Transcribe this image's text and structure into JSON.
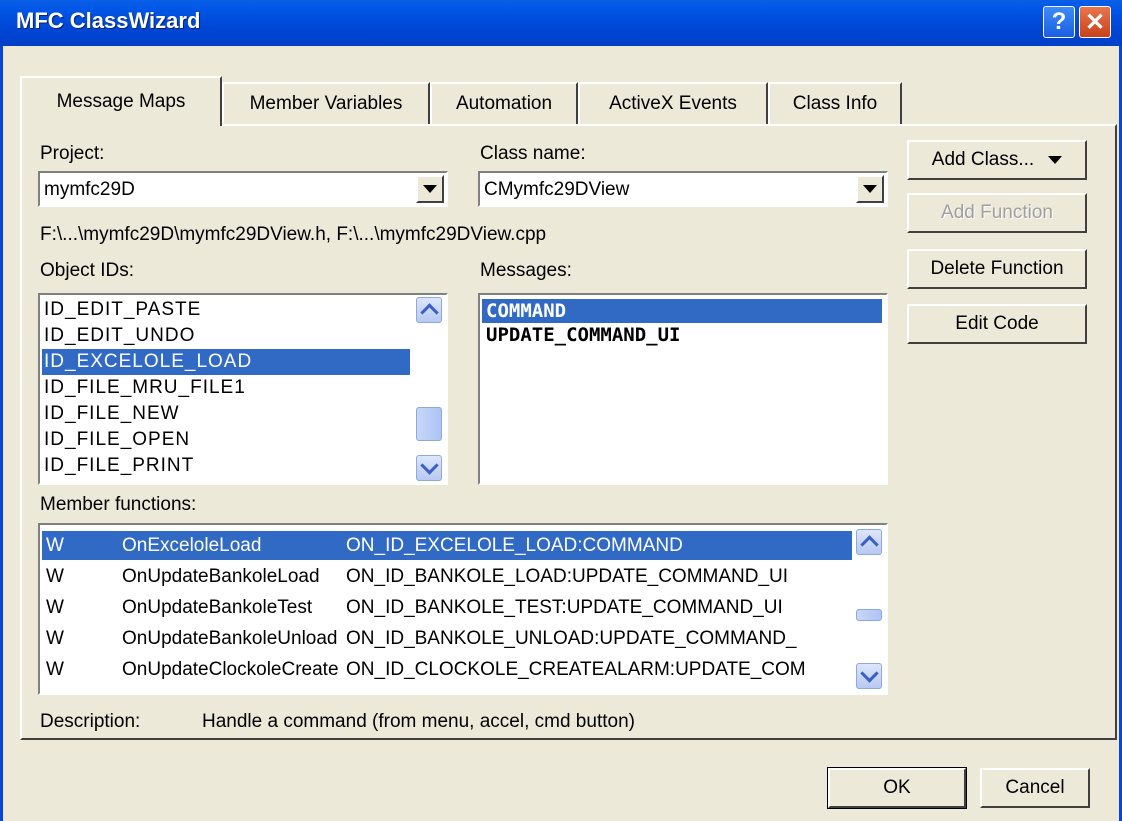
{
  "window": {
    "title": "MFC ClassWizard",
    "help_label": "?",
    "close_label": "✕"
  },
  "tabs": [
    {
      "label": "Message Maps",
      "active": true
    },
    {
      "label": "Member Variables"
    },
    {
      "label": "Automation"
    },
    {
      "label": "ActiveX Events"
    },
    {
      "label": "Class Info"
    }
  ],
  "project": {
    "label": "Project:",
    "value": "mymfc29D"
  },
  "classname": {
    "label": "Class name:",
    "value": "CMymfc29DView"
  },
  "file_path": "F:\\...\\mymfc29D\\mymfc29DView.h, F:\\...\\mymfc29DView.cpp",
  "object_ids": {
    "label": "Object IDs:",
    "items": [
      "ID_EDIT_PASTE",
      "ID_EDIT_UNDO",
      "ID_EXCELOLE_LOAD",
      "ID_FILE_MRU_FILE1",
      "ID_FILE_NEW",
      "ID_FILE_OPEN",
      "ID_FILE_PRINT"
    ],
    "selected": "ID_EXCELOLE_LOAD"
  },
  "messages": {
    "label": "Messages:",
    "items": [
      "COMMAND",
      "UPDATE_COMMAND_UI"
    ],
    "selected": "COMMAND"
  },
  "member_functions": {
    "label": "Member functions:",
    "rows": [
      {
        "marker": "W",
        "name": "OnExceloleLoad",
        "map": "ON_ID_EXCELOLE_LOAD:COMMAND",
        "selected": true
      },
      {
        "marker": "W",
        "name": "OnUpdateBankoleLoad",
        "map": "ON_ID_BANKOLE_LOAD:UPDATE_COMMAND_UI"
      },
      {
        "marker": "W",
        "name": "OnUpdateBankoleTest",
        "map": "ON_ID_BANKOLE_TEST:UPDATE_COMMAND_UI"
      },
      {
        "marker": "W",
        "name": "OnUpdateBankoleUnload",
        "map": "ON_ID_BANKOLE_UNLOAD:UPDATE_COMMAND_"
      },
      {
        "marker": "W",
        "name": "OnUpdateClockoleCreate",
        "map": "ON_ID_CLOCKOLE_CREATEALARM:UPDATE_COM"
      }
    ]
  },
  "description": {
    "label": "Description:",
    "text": "Handle a command (from menu, accel, cmd button)"
  },
  "buttons": {
    "add_class": "Add Class...",
    "add_function": "Add Function",
    "delete_function": "Delete Function",
    "edit_code": "Edit Code",
    "ok": "OK",
    "cancel": "Cancel"
  },
  "colors": {
    "titlebar": "#0050e0",
    "selection": "#316ac5",
    "dialog": "#ece9d8"
  }
}
